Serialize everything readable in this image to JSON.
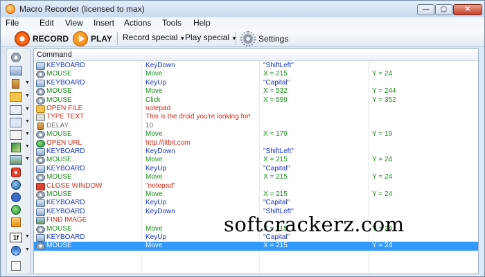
{
  "window": {
    "title": "Macro Recorder (licensed to max)",
    "min_glyph": "—",
    "max_glyph": "▢",
    "close_glyph": "✕"
  },
  "menu": [
    "File",
    "Edit",
    "View",
    "Insert",
    "Actions",
    "Tools",
    "Help"
  ],
  "toolbar": {
    "record_label": "RECORD",
    "play_label": "PLAY",
    "record_special_label": "Record special",
    "play_special_label": "Play special",
    "settings_label": "Settings"
  },
  "sidebar_icons": [
    "mouse-icon",
    "keyboard-icon",
    "delay-icon",
    "open-file-icon",
    "window-icon",
    "type-text-icon",
    "variable-icon",
    "script-icon",
    "image-icon",
    "record-stop-icon",
    "web-icon",
    "info-icon",
    "globe-icon",
    "play-icon",
    "if-icon",
    "repeat-icon",
    "text-icon"
  ],
  "grid": {
    "header": "Command",
    "rows": [
      {
        "icon": "keyboard",
        "command": "KEYBOARD",
        "action": "KeyDown",
        "p1": "\"ShiftLeft\"",
        "p2": "",
        "color": "#1a33c8"
      },
      {
        "icon": "mouse",
        "command": "MOUSE",
        "action": "Move",
        "p1": "X = 215",
        "p2": "Y = 24",
        "color": "#1a8a1a"
      },
      {
        "icon": "keyboard",
        "command": "KEYBOARD",
        "action": "KeyUp",
        "p1": "\"Capital\"",
        "p2": "",
        "color": "#1a33c8"
      },
      {
        "icon": "mouse",
        "command": "MOUSE",
        "action": "Move",
        "p1": "X = 532",
        "p2": "Y = 244",
        "color": "#1a8a1a"
      },
      {
        "icon": "mouse",
        "command": "MOUSE",
        "action": "Click",
        "p1": "X = 599",
        "p2": "Y = 352",
        "color": "#1a8a1a"
      },
      {
        "icon": "openfile",
        "command": "OPEN FILE",
        "action": "notepad",
        "p1": "",
        "p2": "",
        "color": "#d02a1a"
      },
      {
        "icon": "typetext",
        "command": "TYPE TEXT",
        "action": "This is the droid you're looking for!",
        "p1": "",
        "p2": "",
        "color": "#d02a1a"
      },
      {
        "icon": "delay",
        "command": "DELAY",
        "action": "10",
        "p1": "",
        "p2": "",
        "color": "#6b6b6b"
      },
      {
        "icon": "mouse",
        "command": "MOUSE",
        "action": "Move",
        "p1": "X = 179",
        "p2": "Y = 19",
        "color": "#1a8a1a"
      },
      {
        "icon": "openurl",
        "command": "OPEN URL",
        "action": "http://jitbit.com",
        "p1": "",
        "p2": "",
        "color": "#d02a1a"
      },
      {
        "icon": "keyboard",
        "command": "KEYBOARD",
        "action": "KeyDown",
        "p1": "\"ShiftLeft\"",
        "p2": "",
        "color": "#1a33c8"
      },
      {
        "icon": "mouse",
        "command": "MOUSE",
        "action": "Move",
        "p1": "X = 215",
        "p2": "Y = 24",
        "color": "#1a8a1a"
      },
      {
        "icon": "keyboard",
        "command": "KEYBOARD",
        "action": "KeyUp",
        "p1": "\"Capital\"",
        "p2": "",
        "color": "#1a33c8"
      },
      {
        "icon": "mouse",
        "command": "MOUSE",
        "action": "Move",
        "p1": "X = 215",
        "p2": "Y = 24",
        "color": "#1a8a1a"
      },
      {
        "icon": "closewindow",
        "command": "CLOSE WINDOW",
        "action": "\"notepad\"",
        "p1": "",
        "p2": "",
        "color": "#d02a1a"
      },
      {
        "icon": "mouse",
        "command": "MOUSE",
        "action": "Move",
        "p1": "X = 215",
        "p2": "Y = 24",
        "color": "#1a8a1a"
      },
      {
        "icon": "keyboard",
        "command": "KEYBOARD",
        "action": "KeyUp",
        "p1": "\"Capital\"",
        "p2": "",
        "color": "#1a33c8"
      },
      {
        "icon": "keyboard",
        "command": "KEYBOARD",
        "action": "KeyDown",
        "p1": "\"ShiftLeft\"",
        "p2": "",
        "color": "#1a33c8"
      },
      {
        "icon": "findimage",
        "command": "FIND IMAGE",
        "action": "",
        "p1": "",
        "p2": "",
        "color": "#d02a1a"
      },
      {
        "icon": "mouse",
        "command": "MOUSE",
        "action": "Move",
        "p1": "X = 215",
        "p2": "Y = 24",
        "color": "#1a8a1a"
      },
      {
        "icon": "keyboard",
        "command": "KEYBOARD",
        "action": "KeyUp",
        "p1": "\"Capital\"",
        "p2": "",
        "color": "#1a33c8"
      },
      {
        "icon": "mouse",
        "command": "MOUSE",
        "action": "Move",
        "p1": "X = 215",
        "p2": "Y = 24",
        "color": "#ffffff",
        "selected": true
      }
    ]
  },
  "watermark": "softcrackerz.com"
}
